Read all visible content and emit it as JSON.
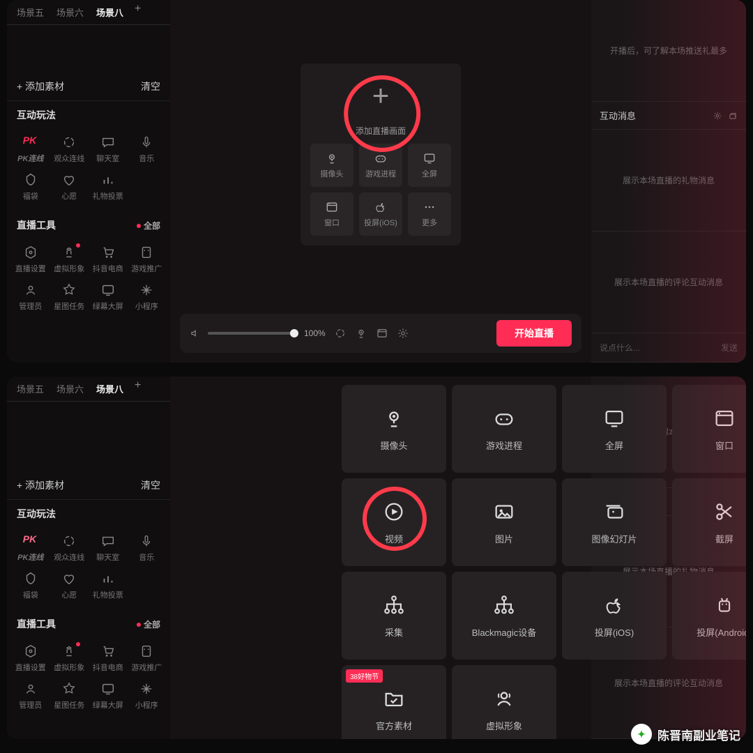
{
  "colors": {
    "accent": "#ff2d55"
  },
  "tabs": [
    "场景五",
    "场景六",
    "场景八"
  ],
  "sidebar": {
    "add_material": "添加素材",
    "clear": "清空",
    "section_interactive": "互动玩法",
    "section_tools": "直播工具",
    "all": "全部",
    "interactive": [
      "PK连线",
      "观众连线",
      "聊天室",
      "音乐",
      "福袋",
      "心愿",
      "礼物投票"
    ],
    "tools": [
      "直播设置",
      "虚拟形象",
      "抖音电商",
      "游戏推广",
      "管理员",
      "星图任务",
      "绿幕大屏",
      "小程序"
    ]
  },
  "addpanel": {
    "title": "添加直播画面",
    "items": [
      "摄像头",
      "游戏进程",
      "全屏",
      "窗口",
      "投屏(iOS)",
      "更多"
    ]
  },
  "ctrl": {
    "volume": "100%",
    "start": "开始直播"
  },
  "right": {
    "info_top": "开播后，可了解本场推送礼最多",
    "messages_title": "互动消息",
    "gifts": "展示本场直播的礼物消息",
    "comments": "展示本场直播的评论互动消息",
    "input_ph": "说点什么...",
    "send": "发送"
  },
  "sources": {
    "items": [
      "摄像头",
      "游戏进程",
      "全屏",
      "窗口",
      "视频",
      "图片",
      "图像幻灯片",
      "截屏",
      "采集",
      "Blackmagic设备",
      "投屏(iOS)",
      "投屏(Android)",
      "官方素材",
      "虚拟形象"
    ],
    "badge": "38好物节"
  },
  "watermark": "陈晋南副业笔记"
}
